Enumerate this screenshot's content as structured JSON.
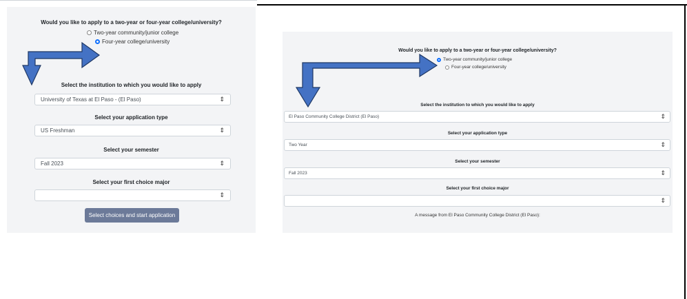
{
  "left_panel": {
    "question": "Would you like to apply to a two-year or four-year college/university?",
    "radio_options": [
      {
        "label": "Two-year community/junior college",
        "checked": false
      },
      {
        "label": "Four-year college/university",
        "checked": true
      }
    ],
    "institution_label": "Select the institution to which you would like to apply",
    "institution_value": "University of Texas at El Paso - (El Paso)",
    "application_type_label": "Select your application type",
    "application_type_value": "US Freshman",
    "semester_label": "Select your semester",
    "semester_value": "Fall 2023",
    "major_label": "Select your first choice major",
    "major_value": "",
    "submit_label": "Select choices and start application"
  },
  "right_panel": {
    "question": "Would you like to apply to a two-year or four-year college/university?",
    "radio_options": [
      {
        "label": "Two-year community/junior college",
        "checked": true
      },
      {
        "label": "Four-year college/university",
        "checked": false
      }
    ],
    "institution_label": "Select the institution to which you would like to apply",
    "institution_value": "El Paso Community College District (El Paso)",
    "application_type_label": "Select your application type",
    "application_type_value": "Two Year",
    "semester_label": "Select your semester",
    "semester_value": "Fall 2023",
    "major_label": "Select your first choice major",
    "major_value": "",
    "message": "A message from El Paso Community College District (El Paso):"
  },
  "icons": {
    "select_caret": "updown-caret-icon",
    "annotation_arrow": "bent-arrow-icon"
  },
  "colors": {
    "arrow_fill": "#4472c4",
    "arrow_stroke": "#1f3864",
    "radio_checked": "#0d6efd",
    "button_bg": "#6c7a99",
    "panel_bg": "#f3f4f6"
  }
}
